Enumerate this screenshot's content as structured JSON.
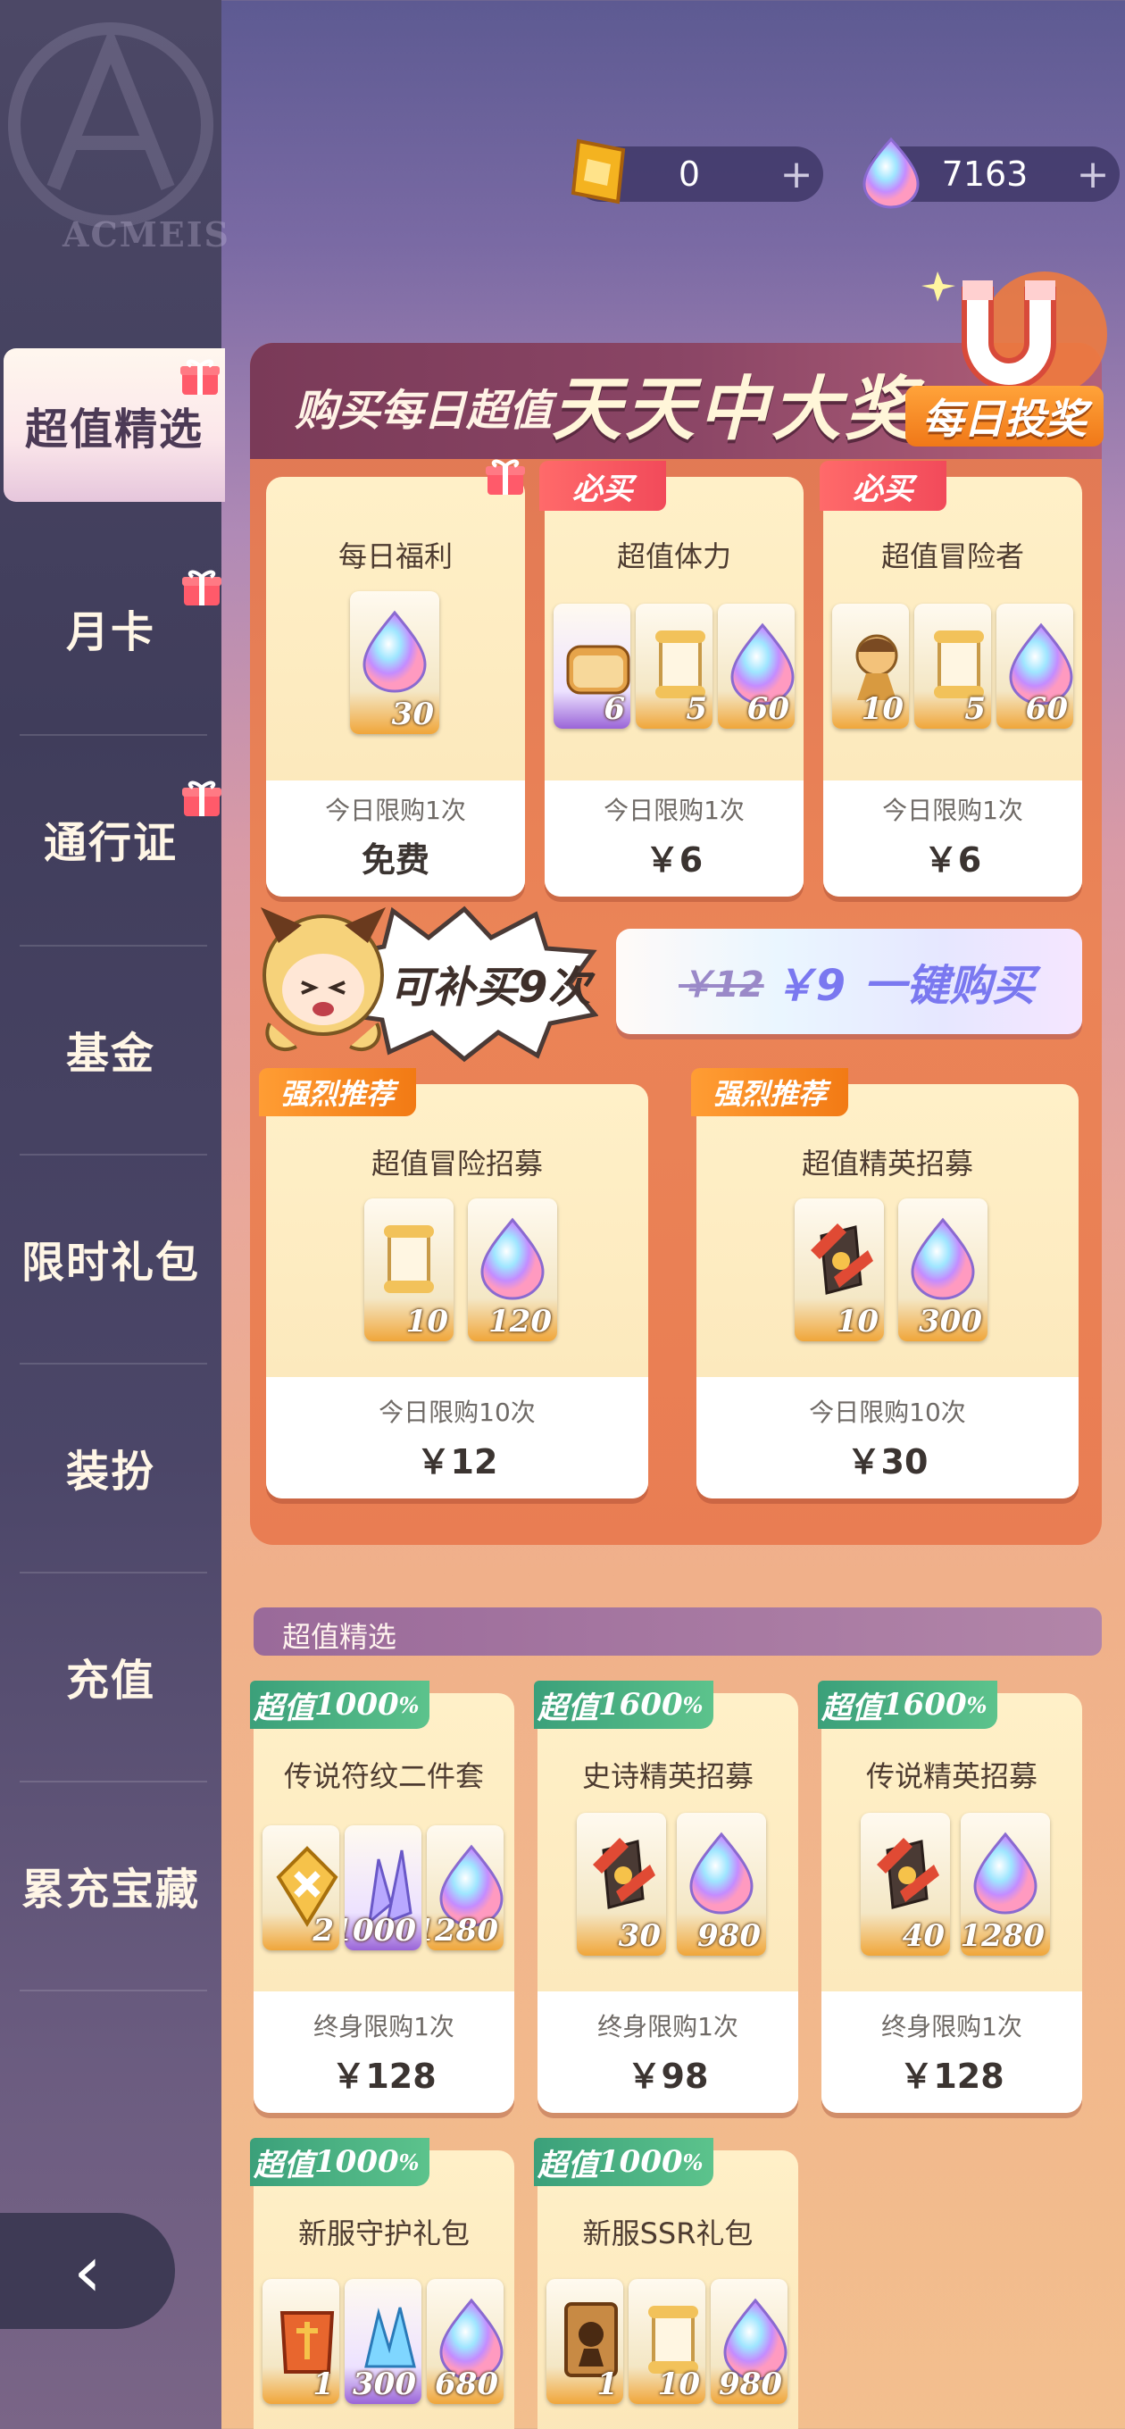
{
  "sidebar": {
    "logo_text": "ACMEIS",
    "items": [
      {
        "label": "超值精选",
        "active": true,
        "gift": true
      },
      {
        "label": "月卡",
        "gift": true
      },
      {
        "label": "通行证",
        "gift": true
      },
      {
        "label": "基金"
      },
      {
        "label": "限时礼包"
      },
      {
        "label": "装扮"
      },
      {
        "label": "充值"
      },
      {
        "label": "累充宝藏"
      }
    ]
  },
  "currency": {
    "gold": "0",
    "crystal": "7163",
    "plus": "+"
  },
  "banner": {
    "small": "购买每日超值",
    "big": "天天中大奖",
    "badge": "每日投奖"
  },
  "daily_cards": [
    {
      "title": "每日福利",
      "limit": "今日限购1次",
      "price": "免费",
      "items": [
        {
          "icon": "crystal-icon",
          "count": "30"
        }
      ]
    },
    {
      "title": "超值体力",
      "tag": "必买",
      "limit": "今日限购1次",
      "price": "￥6",
      "items": [
        {
          "icon": "bread-icon",
          "count": "6",
          "purple": true
        },
        {
          "icon": "scroll-icon",
          "count": "5"
        },
        {
          "icon": "crystal-icon",
          "count": "60"
        }
      ]
    },
    {
      "title": "超值冒险者",
      "tag": "必买",
      "limit": "今日限购1次",
      "price": "￥6",
      "items": [
        {
          "icon": "hero-icon",
          "count": "10"
        },
        {
          "icon": "scroll-icon",
          "count": "5"
        },
        {
          "icon": "crystal-icon",
          "count": "60"
        }
      ]
    }
  ],
  "rebuy": {
    "text": "可补买9次",
    "old_price": "￥12",
    "new_price": "￥9",
    "label": "一键购买"
  },
  "recruit_cards": [
    {
      "tag": "强烈推荐",
      "title": "超值冒险招募",
      "limit": "今日限购10次",
      "price": "￥12",
      "items": [
        {
          "icon": "scroll-icon",
          "count": "10"
        },
        {
          "icon": "crystal-icon",
          "count": "120"
        }
      ]
    },
    {
      "tag": "强烈推荐",
      "title": "超值精英招募",
      "limit": "今日限购10次",
      "price": "￥30",
      "items": [
        {
          "icon": "red-scroll-icon",
          "count": "10"
        },
        {
          "icon": "crystal-icon",
          "count": "300"
        }
      ]
    }
  ],
  "section_title": "超值精选",
  "value_cards": [
    {
      "tag_prefix": "超值",
      "tag_num": "1000",
      "tag_pct": "%",
      "title": "传说符纹二件套",
      "limit": "终身限购1次",
      "price": "￥128",
      "items": [
        {
          "icon": "rune-icon",
          "count": "2"
        },
        {
          "icon": "shard-icon",
          "count": "1000",
          "purple": true
        },
        {
          "icon": "crystal-icon",
          "count": "1280"
        }
      ]
    },
    {
      "tag_prefix": "超值",
      "tag_num": "1600",
      "tag_pct": "%",
      "title": "史诗精英招募",
      "limit": "终身限购1次",
      "price": "￥98",
      "items": [
        {
          "icon": "red-scroll-icon",
          "count": "30"
        },
        {
          "icon": "crystal-icon",
          "count": "980"
        }
      ]
    },
    {
      "tag_prefix": "超值",
      "tag_num": "1600",
      "tag_pct": "%",
      "title": "传说精英招募",
      "limit": "终身限购1次",
      "price": "￥128",
      "items": [
        {
          "icon": "red-scroll-icon",
          "count": "40"
        },
        {
          "icon": "crystal-icon",
          "count": "1280"
        }
      ]
    },
    {
      "tag_prefix": "超值",
      "tag_num": "1000",
      "tag_pct": "%",
      "title": "新服守护礼包",
      "items": [
        {
          "icon": "armor-icon",
          "count": "1"
        },
        {
          "icon": "blue-crystal-icon",
          "count": "300",
          "purple": true
        },
        {
          "icon": "crystal-icon",
          "count": "680"
        }
      ]
    },
    {
      "tag_prefix": "超值",
      "tag_num": "1000",
      "tag_pct": "%",
      "title": "新服SSR礼包",
      "items": [
        {
          "icon": "ssr-card-icon",
          "count": "1"
        },
        {
          "icon": "scroll-icon",
          "count": "10"
        },
        {
          "icon": "crystal-icon",
          "count": "980"
        }
      ]
    }
  ],
  "back_label": "‹"
}
